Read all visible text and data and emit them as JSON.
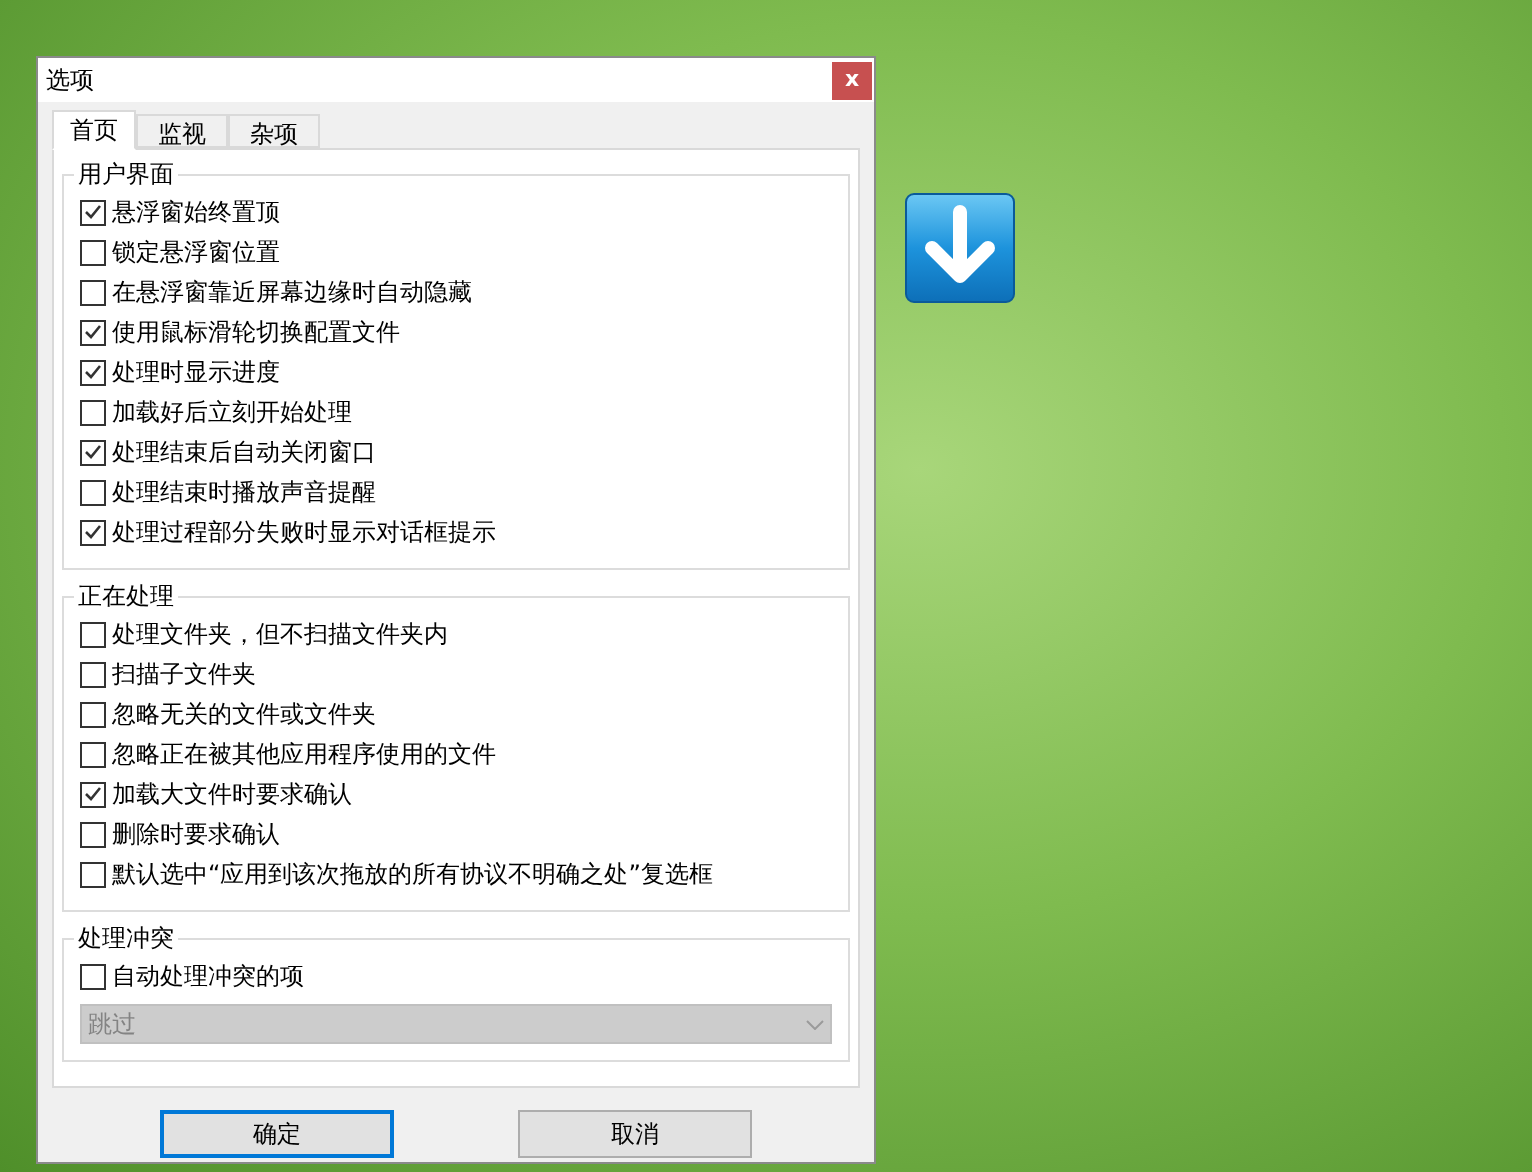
{
  "window": {
    "title": "选项",
    "close": "x"
  },
  "tabs": [
    {
      "label": "首页",
      "selected": true
    },
    {
      "label": "监视",
      "selected": false
    },
    {
      "label": "杂项",
      "selected": false
    }
  ],
  "groups": [
    {
      "title": "用户界面",
      "items": [
        {
          "kind": "checkbox",
          "label": "悬浮窗始终置顶",
          "checked": true
        },
        {
          "kind": "checkbox",
          "label": "锁定悬浮窗位置",
          "checked": false
        },
        {
          "kind": "checkbox",
          "label": "在悬浮窗靠近屏幕边缘时自动隐藏",
          "checked": false
        },
        {
          "kind": "checkbox",
          "label": "使用鼠标滑轮切换配置文件",
          "checked": true
        },
        {
          "kind": "checkbox",
          "label": "处理时显示进度",
          "checked": true
        },
        {
          "kind": "checkbox",
          "label": "加载好后立刻开始处理",
          "checked": false
        },
        {
          "kind": "checkbox",
          "label": "处理结束后自动关闭窗口",
          "checked": true
        },
        {
          "kind": "checkbox",
          "label": "处理结束时播放声音提醒",
          "checked": false
        },
        {
          "kind": "checkbox",
          "label": "处理过程部分失败时显示对话框提示",
          "checked": true
        }
      ]
    },
    {
      "title": "正在处理",
      "items": [
        {
          "kind": "checkbox",
          "label": "处理文件夹，但不扫描文件夹内",
          "checked": false
        },
        {
          "kind": "checkbox",
          "label": "扫描子文件夹",
          "checked": false
        },
        {
          "kind": "checkbox",
          "label": "忽略无关的文件或文件夹",
          "checked": false
        },
        {
          "kind": "checkbox",
          "label": "忽略正在被其他应用程序使用的文件",
          "checked": false
        },
        {
          "kind": "checkbox",
          "label": "加载大文件时要求确认",
          "checked": true
        },
        {
          "kind": "checkbox",
          "label": "删除时要求确认",
          "checked": false
        },
        {
          "kind": "checkbox",
          "label": "默认选中“应用到该次拖放的所有协议不明确之处”复选框",
          "checked": false
        }
      ]
    },
    {
      "title": "处理冲突",
      "items": [
        {
          "kind": "checkbox",
          "label": "自动处理冲突的项",
          "checked": false
        },
        {
          "kind": "dropdown",
          "value": "跳过",
          "disabled": true
        }
      ]
    }
  ],
  "buttons": [
    {
      "label": "确定",
      "default": true
    },
    {
      "label": "取消",
      "default": false
    }
  ]
}
